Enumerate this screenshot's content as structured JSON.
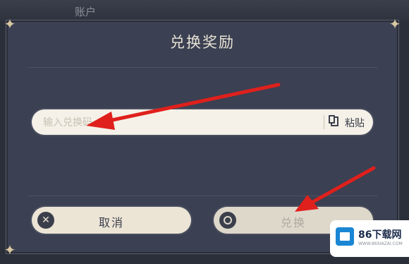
{
  "background": {
    "account_label": "账户"
  },
  "dialog": {
    "title": "兑换奖励",
    "code_field": {
      "placeholder": "输入兑换码"
    },
    "paste_label": "粘贴",
    "cancel_label": "取消",
    "redeem_label": "兑换"
  },
  "watermark": {
    "title": "86下载网",
    "subtitle": "WWW.86XIAZAI.COM"
  },
  "colors": {
    "dialog_bg": "#3b4052",
    "button_bg": "#ece5d6",
    "arrow": "#e0201c",
    "brand_blue": "#1a86d4"
  }
}
